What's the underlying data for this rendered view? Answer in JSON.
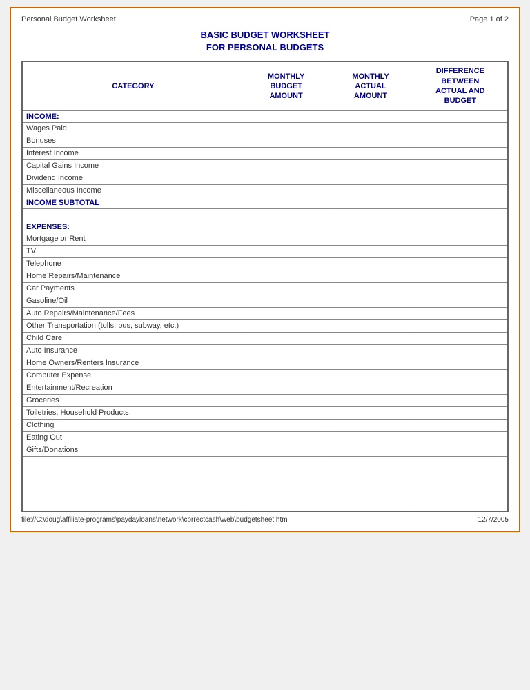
{
  "header": {
    "left": "Personal Budget Worksheet",
    "right": "Page 1 of 2"
  },
  "title_line1": "BASIC BUDGET WORKSHEET",
  "title_line2": "FOR PERSONAL BUDGETS",
  "columns": {
    "category": "CATEGORY",
    "monthly_budget": "MONTHLY\nBUDGET\nAMOUNT",
    "monthly_actual": "MONTHLY\nACTUAL\nAMOUNT",
    "difference": "DIFFERENCE\nBETWEEN\nACTUAL AND\nBUDGET"
  },
  "income_label": "INCOME:",
  "income_rows": [
    "Wages Paid",
    "Bonuses",
    "Interest Income",
    "Capital Gains Income",
    "Dividend Income",
    "Miscellaneous Income"
  ],
  "income_subtotal": "INCOME SUBTOTAL",
  "expenses_label": "EXPENSES:",
  "expenses_rows": [
    "Mortgage or Rent",
    "TV",
    "Telephone",
    "Home Repairs/Maintenance",
    "Car Payments",
    "Gasoline/Oil",
    "Auto Repairs/Maintenance/Fees",
    "Other Transportation (tolls, bus, subway, etc.)",
    "Child Care",
    "Auto Insurance",
    "Home Owners/Renters Insurance",
    "Computer Expense",
    "Entertainment/Recreation",
    "Groceries",
    "Toiletries, Household Products",
    "Clothing",
    "Eating Out",
    "Gifts/Donations"
  ],
  "footer": {
    "left": "file://C:\\doug\\affiliate-programs\\paydayloans\\network\\correctcash\\web\\budgetsheet.htm",
    "right": "12/7/2005"
  }
}
